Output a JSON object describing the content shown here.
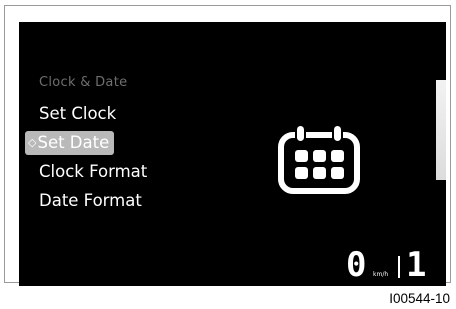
{
  "menu": {
    "title": "Clock & Date",
    "items": [
      {
        "label": "Set Clock",
        "selected": false
      },
      {
        "label": "Set Date",
        "selected": true
      },
      {
        "label": "Clock Format",
        "selected": false
      },
      {
        "label": "Date Format",
        "selected": false
      }
    ],
    "selection_marker": "◇"
  },
  "icon": "calendar-icon",
  "speed": {
    "value": "0",
    "unit": "km/h"
  },
  "gear": {
    "value": "1"
  },
  "reference_code": "I00544-10",
  "colors": {
    "screen": "#000000",
    "highlight": "#b9b9b9",
    "title": "#6e6e6e",
    "text": "#ffffff"
  }
}
